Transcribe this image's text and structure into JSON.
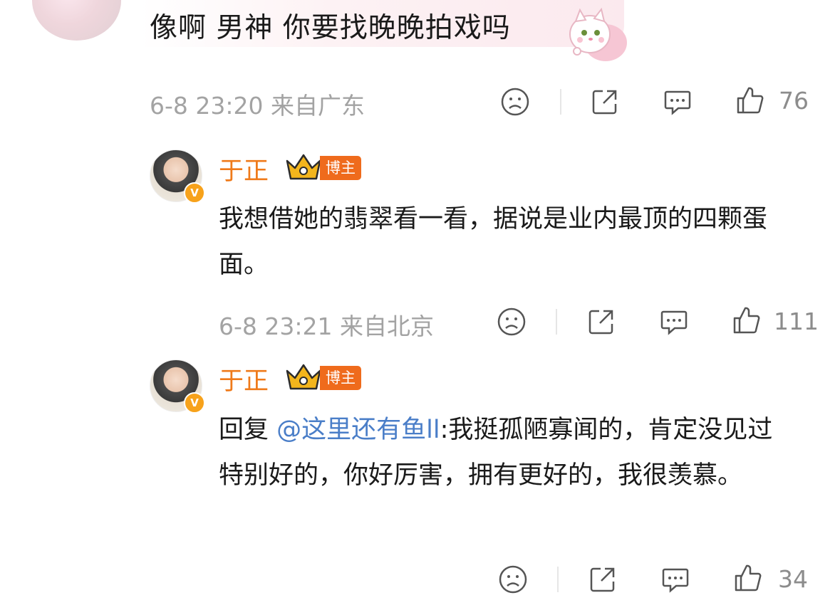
{
  "top_comment": {
    "text": "像啊 男神 你要找晚晚拍戏吗",
    "time": "6-8 23:20",
    "location": "来自广东",
    "like_count": "76"
  },
  "replies": [
    {
      "username": "于正",
      "badge": "博主",
      "verified_mark": "V",
      "text": "我想借她的翡翠看一看，据说是业内最顶的四颗蛋面。",
      "time": "6-8 23:21",
      "location": "来自北京",
      "like_count": "111"
    },
    {
      "username": "于正",
      "badge": "博主",
      "verified_mark": "V",
      "reply_prefix": "回复",
      "mention": "@这里还有鱼ll",
      "text": ":我挺孤陋寡闻的，肯定没见过特别好的，你好厉害，拥有更好的，我很羡慕。",
      "like_count": "34"
    }
  ],
  "icons": {
    "dislike": "sad-face-icon",
    "share": "share-icon",
    "comment": "comment-icon",
    "like": "thumbs-up-icon",
    "crown": "crown-icon"
  },
  "colors": {
    "username": "#ef7a1a",
    "badge_bg": "#ef6b1c",
    "mention": "#4a7ec8",
    "meta": "#a3a3a3",
    "verified": "#f7a21b"
  }
}
